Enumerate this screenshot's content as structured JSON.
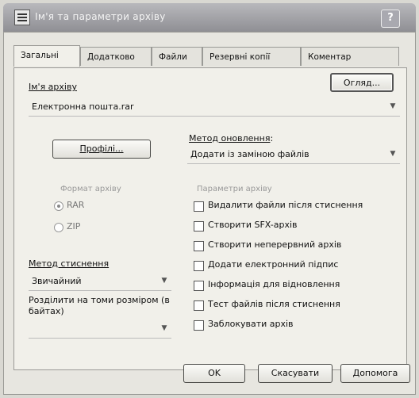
{
  "window": {
    "title": "Ім'я та параметри архіву",
    "help": "?"
  },
  "tabs": [
    {
      "label": "Загальні"
    },
    {
      "label": "Додатково"
    },
    {
      "label": "Файли"
    },
    {
      "label": "Резервні копії"
    },
    {
      "label": "Коментар"
    }
  ],
  "archive_name": {
    "label": "Ім'я архіву",
    "value": "Електронна пошта.rar",
    "browse_label": "Огляд..."
  },
  "profiles_label": "Профілі...",
  "update_method": {
    "label": "Метод оновлення",
    "value": "Додати із заміною файлів"
  },
  "archive_format": {
    "label": "Формат архіву",
    "options": [
      {
        "label": "RAR",
        "checked": true
      },
      {
        "label": "ZIP",
        "checked": false
      }
    ]
  },
  "compression": {
    "label": "Метод стиснення",
    "value": "Звичайний"
  },
  "split": {
    "label": "Розділити на томи розміром (в байтах)"
  },
  "archive_options": {
    "label": "Параметри архіву",
    "items": [
      {
        "label": "Видалити файли після стиснення",
        "checked": false
      },
      {
        "label": "Створити SFX-архів",
        "checked": false
      },
      {
        "label": "Створити неперервний архів",
        "checked": false
      },
      {
        "label": "Додати електронний підпис",
        "checked": false
      },
      {
        "label": "Інформація для відновлення",
        "checked": false
      },
      {
        "label": "Тест файлів після стиснення",
        "checked": false
      },
      {
        "label": "Заблокувати архів",
        "checked": false
      }
    ]
  },
  "footer": {
    "ok": "OK",
    "cancel": "Скасувати",
    "help": "Допомога"
  }
}
